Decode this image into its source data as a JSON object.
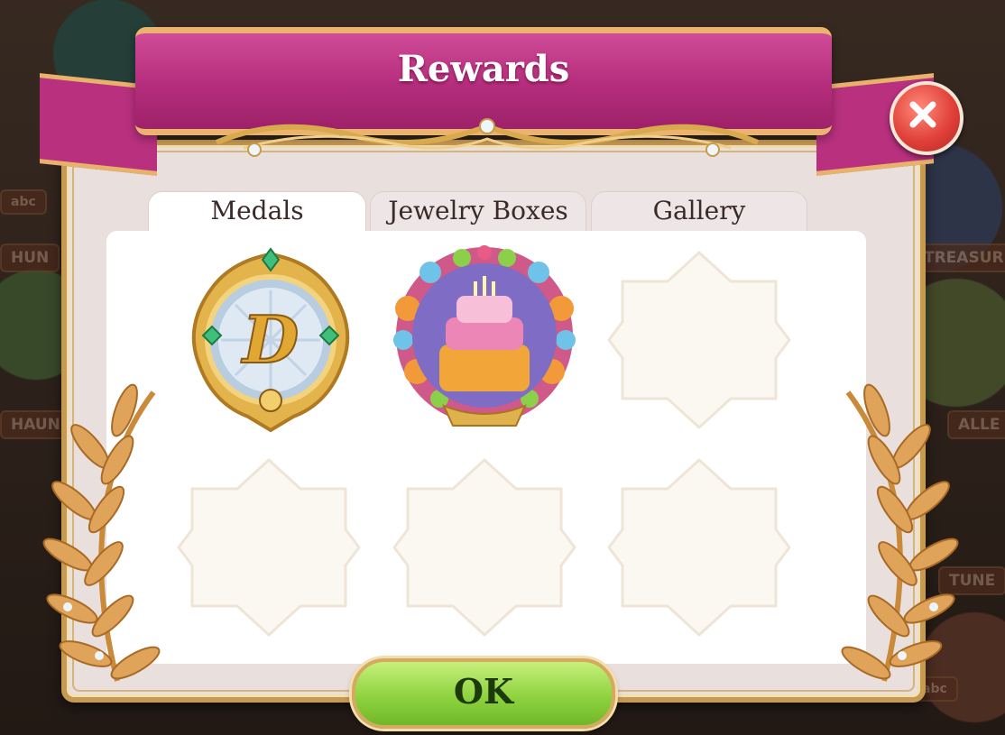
{
  "dialog": {
    "title": "Rewards",
    "ok_label": "OK"
  },
  "tabs": [
    {
      "label": "Medals",
      "active": true
    },
    {
      "label": "Jewelry Boxes",
      "active": false
    },
    {
      "label": "Gallery",
      "active": false
    }
  ],
  "medals": [
    {
      "kind": "letter-medal",
      "letter": "D",
      "earned": true
    },
    {
      "kind": "birthday-cake-medal",
      "earned": true
    },
    {
      "kind": "empty-slot",
      "earned": false
    },
    {
      "kind": "empty-slot",
      "earned": false
    },
    {
      "kind": "empty-slot",
      "earned": false
    },
    {
      "kind": "empty-slot",
      "earned": false
    }
  ],
  "background_labels": [
    "abc",
    "HUN",
    "HAUN",
    "TREASURE",
    "ALLE",
    "TUNE",
    "abc"
  ],
  "colors": {
    "ribbon": "#b42d7c",
    "gold_trim": "#eab46e",
    "ok_button": "#8fd340",
    "close_button": "#e1413a"
  }
}
